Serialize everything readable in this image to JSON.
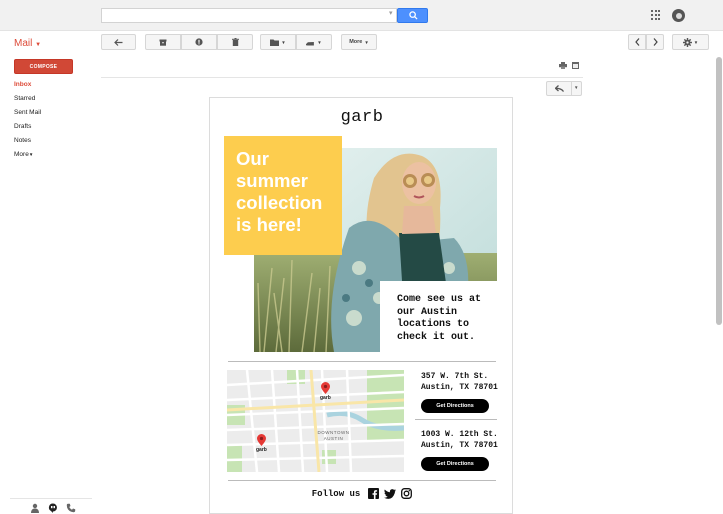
{
  "mail": {
    "app_label": "Mail",
    "compose_label": "COMPOSE",
    "nav": [
      {
        "label": "Inbox",
        "active": true
      },
      {
        "label": "Starred",
        "active": false
      },
      {
        "label": "Sent Mail",
        "active": false
      },
      {
        "label": "Drafts",
        "active": false
      },
      {
        "label": "Notes",
        "active": false
      },
      {
        "label": "More",
        "active": false
      }
    ],
    "toolbar": {
      "more_label": "More"
    },
    "colors": {
      "brand": "#dd4b39",
      "search": "#4d90fe"
    }
  },
  "search": {
    "placeholder": "",
    "value": ""
  },
  "email": {
    "brand": "garb",
    "headline": "Our summer collection is here!",
    "cta": "Come see us at our Austin locations to check it out.",
    "locations": [
      {
        "address": "357 W. 7th St. Austin, TX 78701",
        "button": "Get Directions"
      },
      {
        "address": "1003 W. 12th St. Austin, TX 78701",
        "button": "Get Directions"
      }
    ],
    "map": {
      "district_label": "DOWNTOWN AUSTIN",
      "pins": [
        {
          "label": "garb"
        },
        {
          "label": "garb"
        }
      ]
    },
    "follow_label": "Follow us",
    "social": [
      "facebook-icon",
      "twitter-icon",
      "instagram-icon"
    ],
    "colors": {
      "promo": "#fdcd4e",
      "button": "#000000"
    }
  }
}
